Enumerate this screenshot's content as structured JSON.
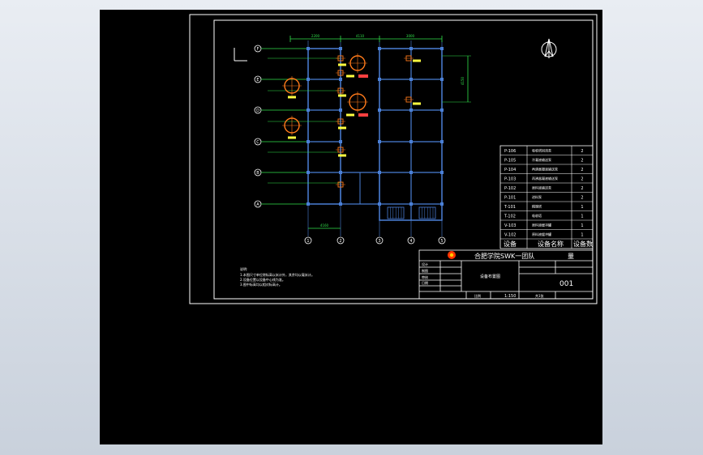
{
  "colors": {
    "background": "#000000",
    "frame": "#ffffff",
    "structure": "#4a7fd6",
    "dimension": "#30e04a",
    "equipment": "#ff7a1a",
    "annotation": "#ffff40",
    "text": "#ffffff"
  },
  "icons": {
    "north_arrow": "compass-north-arrow-icon",
    "logo": "university-logo-icon"
  },
  "grid": {
    "rows": [
      "F",
      "E",
      "D",
      "C",
      "B",
      "A"
    ],
    "cols": [
      "1",
      "2",
      "3",
      "4",
      "5"
    ],
    "top_dims": [
      "2200",
      "4110",
      "3000"
    ],
    "right_dim": "4150",
    "bottom_dim": "4160"
  },
  "notes": {
    "title": "说明:",
    "lines": [
      "1.本图尺寸单位除标高以米计外，其余均以毫米计。",
      "2.设备位置以设备中心线为准。",
      "3.图中标高均以相对标高计。"
    ]
  },
  "equipment_table": {
    "rows": [
      {
        "tag": "P-106",
        "name": "吸收塔回流泵",
        "qty": "2"
      },
      {
        "tag": "P-105",
        "name": "冷凝液输送泵",
        "qty": "2"
      },
      {
        "tag": "P-104",
        "name": "再沸器凝液输送泵",
        "qty": "2"
      },
      {
        "tag": "P-103",
        "name": "再沸器凝液输送泵",
        "qty": "2"
      },
      {
        "tag": "P-102",
        "name": "原料液输送泵",
        "qty": "2"
      },
      {
        "tag": "P-101",
        "name": "进料泵",
        "qty": "2"
      },
      {
        "tag": "T-101",
        "name": "精馏塔",
        "qty": "1"
      },
      {
        "tag": "T-102",
        "name": "吸收塔",
        "qty": "1"
      },
      {
        "tag": "V-103",
        "name": "原料液缓冲罐",
        "qty": "1"
      },
      {
        "tag": "V-102",
        "name": "原料液缓冲罐",
        "qty": "1"
      }
    ],
    "header": {
      "col1": "设备",
      "col2": "设备名称",
      "col3": "设备数"
    }
  },
  "title_block": {
    "school": "合肥学院",
    "team": "SWK一团队",
    "word": "量",
    "drawing_title": "设备布置图",
    "number": "001",
    "scale_label": "比例",
    "scale": "1:150",
    "sheet": "共1张",
    "roles": [
      "设计",
      "制图",
      "审核",
      "日期"
    ]
  }
}
